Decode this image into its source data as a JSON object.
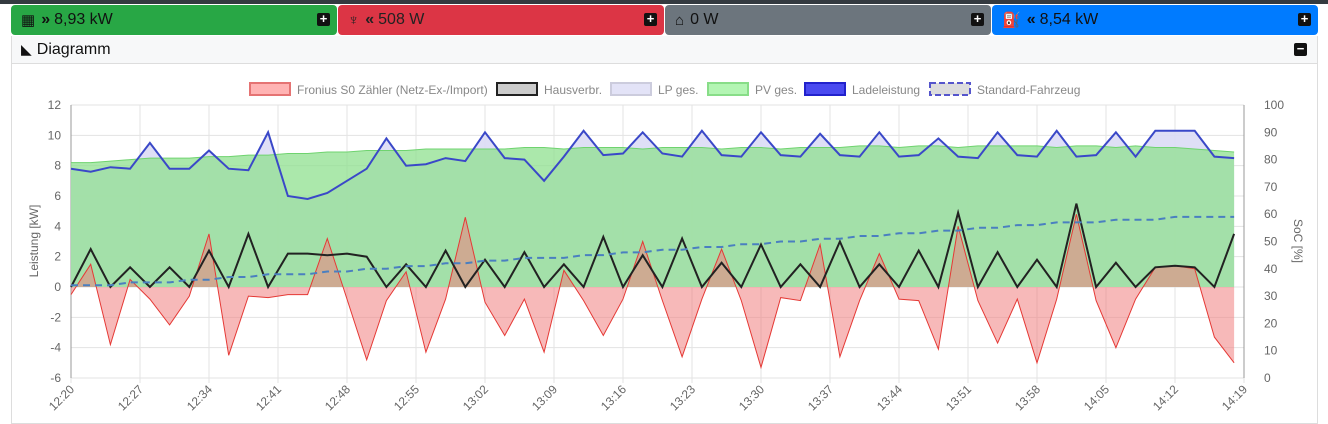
{
  "status_bar": [
    {
      "icon": "solar-panel-icon",
      "arrows": "»",
      "value": "8,93 kW",
      "color": "#28a745"
    },
    {
      "icon": "power-tower-icon",
      "arrows": "«",
      "value": "508 W",
      "color": "#dc3545"
    },
    {
      "icon": "home-icon",
      "arrows": "",
      "value": "0 W",
      "color": "#6c757d"
    },
    {
      "icon": "charging-station-icon",
      "arrows": "«",
      "value": "8,54 kW",
      "color": "#007bff"
    }
  ],
  "card": {
    "title": "Diagramm"
  },
  "chart_data": {
    "type": "line",
    "legend": [
      "Fronius S0 Zähler (Netz-Ex-/Import)",
      "Hausverbr.",
      "LP ges.",
      "PV ges.",
      "Ladeleistung",
      "Standard-Fahrzeug"
    ],
    "legend_placement": "top",
    "ylabel": "Leistung [kW]",
    "y2label": "SoC [%]",
    "ylim": [
      -6,
      12
    ],
    "y2lim": [
      0,
      100
    ],
    "yticks": [
      "12",
      "10",
      "8",
      "6",
      "4",
      "2",
      "0",
      "-2",
      "-4",
      "-6"
    ],
    "y2ticks": [
      "100",
      "90",
      "80",
      "70",
      "60",
      "50",
      "40",
      "30",
      "20",
      "10",
      "0"
    ],
    "xticks": [
      "12:20",
      "12:27",
      "12:34",
      "12:41",
      "12:48",
      "12:55",
      "13:02",
      "13:09",
      "13:16",
      "13:23",
      "13:30",
      "13:37",
      "13:44",
      "13:51",
      "13:58",
      "14:05",
      "14:12",
      "14:19"
    ],
    "x_start": "12:20",
    "x_step_min": 2,
    "x_range_min": [
      0,
      119
    ],
    "series": {
      "grid": [
        -0.5,
        1.5,
        -3.8,
        0.5,
        -0.8,
        -2.5,
        -0.6,
        3.5,
        -4.5,
        -0.6,
        -0.7,
        -0.5,
        -0.5,
        3.2,
        -0.8,
        -4.8,
        -0.9,
        1.0,
        -4.3,
        -0.8,
        4.6,
        -1.0,
        -3.2,
        -0.8,
        -4.3,
        1.1,
        -0.9,
        -3.2,
        -0.8,
        3.0,
        -0.9,
        -4.6,
        -0.8,
        2.5,
        -0.9,
        -5.3,
        -0.7,
        -0.9,
        2.8,
        -4.6,
        -0.9,
        2.2,
        -0.8,
        -0.9,
        -4.1,
        4.0,
        -0.9,
        -3.7,
        -0.8,
        -5.0,
        -0.8,
        4.8,
        -0.9,
        -4.0,
        -0.8,
        1.3,
        1.4,
        1.2,
        -3.3,
        -5.0
      ],
      "house": [
        0,
        2.5,
        0,
        1.3,
        0,
        1.3,
        0,
        2.4,
        0,
        3.5,
        0,
        2.2,
        2.2,
        2.1,
        2.2,
        2.0,
        0,
        1.5,
        0,
        2.4,
        0,
        1.8,
        0,
        2.3,
        0,
        1.5,
        0,
        3.3,
        0,
        2.1,
        0,
        3.2,
        0,
        1.6,
        0,
        2.8,
        0,
        1.5,
        0,
        3.0,
        0,
        1.5,
        0,
        2.4,
        0,
        4.9,
        0,
        2.3,
        0,
        1.8,
        0,
        5.5,
        0,
        1.6,
        0,
        1.3,
        1.4,
        1.3,
        0,
        3.5
      ],
      "pv": [
        8.2,
        8.2,
        8.3,
        8.4,
        8.5,
        8.5,
        8.5,
        8.6,
        8.6,
        8.7,
        8.7,
        8.8,
        8.8,
        8.9,
        8.9,
        9.0,
        9.0,
        9.0,
        9.1,
        9.1,
        9.1,
        9.1,
        9.1,
        9.2,
        9.2,
        9.1,
        9.2,
        9.2,
        9.2,
        9.1,
        9.2,
        9.2,
        9.2,
        9.1,
        9.2,
        9.2,
        9.1,
        9.2,
        9.2,
        9.2,
        9.3,
        9.3,
        9.2,
        9.3,
        9.3,
        9.2,
        9.3,
        9.3,
        9.3,
        9.3,
        9.2,
        9.3,
        9.3,
        9.2,
        9.3,
        9.2,
        9.2,
        9.1,
        9.0,
        8.9
      ],
      "charge": [
        7.8,
        7.6,
        7.9,
        7.8,
        9.5,
        7.8,
        7.8,
        9.0,
        7.8,
        7.7,
        10.2,
        6.0,
        5.8,
        6.2,
        7.0,
        7.8,
        9.8,
        8.0,
        8.1,
        8.5,
        8.3,
        10.2,
        8.5,
        8.4,
        7.0,
        8.6,
        10.3,
        8.7,
        8.8,
        10.2,
        8.8,
        8.6,
        10.3,
        8.7,
        8.6,
        10.2,
        8.7,
        8.6,
        10.1,
        8.7,
        8.6,
        10.2,
        8.6,
        8.7,
        9.8,
        8.6,
        8.5,
        10.2,
        8.7,
        8.6,
        10.3,
        8.6,
        8.7,
        10.2,
        8.6,
        10.3,
        10.3,
        10.3,
        8.6,
        8.5
      ],
      "soc": [
        34,
        34,
        34,
        35,
        35,
        35,
        36,
        36,
        37,
        37,
        38,
        38,
        38,
        39,
        39,
        40,
        40,
        41,
        41,
        42,
        42,
        43,
        43,
        44,
        44,
        44,
        45,
        45,
        46,
        46,
        47,
        47,
        48,
        48,
        49,
        49,
        50,
        50,
        51,
        51,
        52,
        52,
        53,
        53,
        54,
        54,
        55,
        55,
        56,
        56,
        57,
        57,
        57,
        58,
        58,
        58,
        59,
        59,
        59,
        59
      ]
    },
    "colors": {
      "grid": "#e53935",
      "house": "#222222",
      "lp": "#dcdcf5",
      "pv": "#8fe08f",
      "charge": "#3a48c8",
      "soc": "#4a7fc0"
    }
  }
}
